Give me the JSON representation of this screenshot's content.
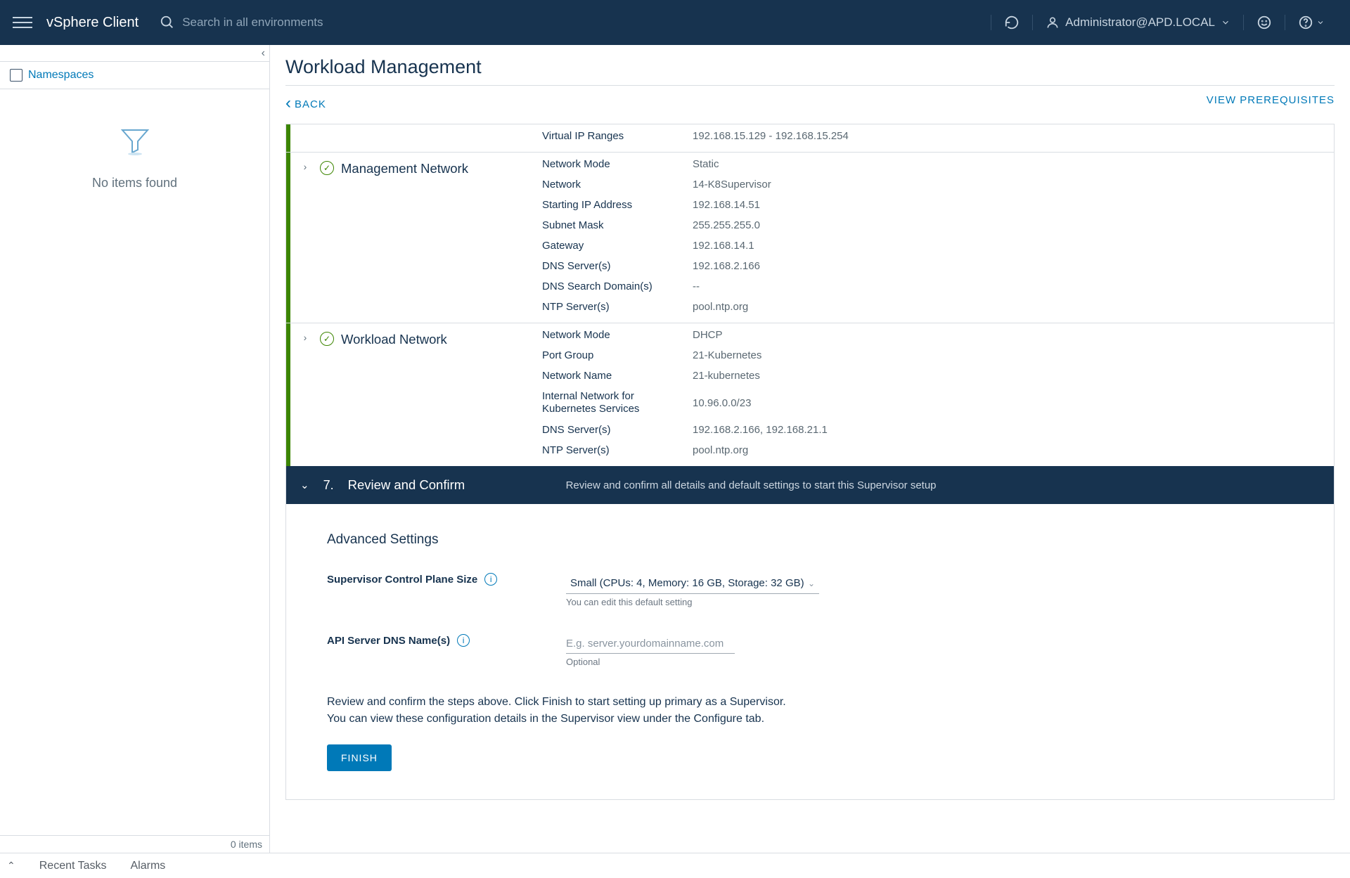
{
  "header": {
    "brand": "vSphere Client",
    "searchPlaceholder": "Search in all environments",
    "user": "Administrator@APD.LOCAL"
  },
  "sidebar": {
    "node": "Namespaces",
    "emptyMsg": "No items found",
    "footer": "0 items"
  },
  "page": {
    "title": "Workload Management",
    "back": "BACK",
    "viewPrereq": "VIEW PREREQUISITES"
  },
  "step_vip": {
    "rows": [
      {
        "k": "Virtual IP Ranges",
        "v": "192.168.15.129 - 192.168.15.254"
      }
    ]
  },
  "step_mgmt": {
    "title": "Management Network",
    "rows": [
      {
        "k": "Network Mode",
        "v": "Static"
      },
      {
        "k": "Network",
        "v": "14-K8Supervisor"
      },
      {
        "k": "Starting IP Address",
        "v": "192.168.14.51"
      },
      {
        "k": "Subnet Mask",
        "v": "255.255.255.0"
      },
      {
        "k": "Gateway",
        "v": "192.168.14.1"
      },
      {
        "k": "DNS Server(s)",
        "v": "192.168.2.166"
      },
      {
        "k": "DNS Search Domain(s)",
        "v": "--"
      },
      {
        "k": "NTP Server(s)",
        "v": "pool.ntp.org"
      }
    ]
  },
  "step_wl": {
    "title": "Workload Network",
    "rows": [
      {
        "k": "Network Mode",
        "v": "DHCP"
      },
      {
        "k": "Port Group",
        "v": "21-Kubernetes"
      },
      {
        "k": "Network Name",
        "v": "21-kubernetes"
      },
      {
        "k": "Internal Network for Kubernetes Services",
        "v": "10.96.0.0/23"
      },
      {
        "k": "DNS Server(s)",
        "v": "192.168.2.166, 192.168.21.1"
      },
      {
        "k": "NTP Server(s)",
        "v": "pool.ntp.org"
      }
    ]
  },
  "step7": {
    "num": "7.",
    "title": "Review and Confirm",
    "desc": "Review and confirm all details and default settings to start this Supervisor setup"
  },
  "adv": {
    "title": "Advanced Settings",
    "sizeLabel": "Supervisor Control Plane Size",
    "sizeValue": "Small (CPUs: 4, Memory: 16 GB, Storage: 32 GB)",
    "sizeHelper": "You can edit this default setting",
    "dnsLabel": "API Server DNS Name(s)",
    "dnsPlaceholder": "E.g. server.yourdomainname.com",
    "dnsHelper": "Optional",
    "confirmLine1": "Review and confirm the steps above. Click Finish to start setting up primary as a Supervisor.",
    "confirmLine2": "You can view these configuration details in the Supervisor view under the Configure tab.",
    "finish": "FINISH"
  },
  "bottom": {
    "recent": "Recent Tasks",
    "alarms": "Alarms"
  }
}
